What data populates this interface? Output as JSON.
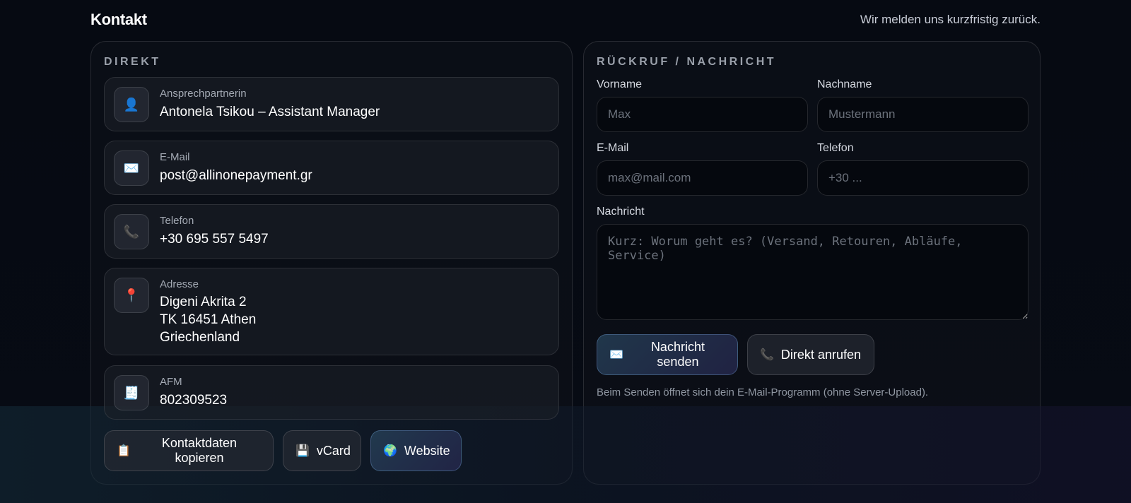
{
  "header": {
    "title": "Kontakt",
    "tagline": "Wir melden uns kurzfristig zurück."
  },
  "direct": {
    "section_title": "DIREKT",
    "contact_person": {
      "label": "Ansprechpartnerin",
      "value": "Antonela Tsikou – Assistant Manager",
      "icon": "👤"
    },
    "email": {
      "label": "E-Mail",
      "value": "post@allinonepayment.gr",
      "icon": "✉️"
    },
    "phone": {
      "label": "Telefon",
      "value": "+30 695 557 5497",
      "icon": "📞"
    },
    "address": {
      "label": "Adresse",
      "lines": [
        "Digeni Akrita 2",
        "TK 16451 Athen",
        "Griechenland"
      ],
      "icon": "📍"
    },
    "afm": {
      "label": "AFM",
      "value": "802309523",
      "icon": "🧾"
    },
    "buttons": {
      "copy": {
        "label": "Kontaktdaten kopieren",
        "icon": "📋"
      },
      "vcard": {
        "label": "vCard",
        "icon": "💾"
      },
      "website": {
        "label": "Website",
        "icon": "🌍"
      }
    }
  },
  "form": {
    "section_title": "RÜCKRUF / NACHRICHT",
    "firstname": {
      "label": "Vorname",
      "placeholder": "Max",
      "value": ""
    },
    "lastname": {
      "label": "Nachname",
      "placeholder": "Mustermann",
      "value": ""
    },
    "email": {
      "label": "E-Mail",
      "placeholder": "max@mail.com",
      "value": ""
    },
    "phone": {
      "label": "Telefon",
      "placeholder": "+30 ...",
      "value": ""
    },
    "message": {
      "label": "Nachricht",
      "placeholder": "Kurz: Worum geht es? (Versand, Retouren, Abläufe, Service)",
      "value": ""
    },
    "send_button": {
      "label": "Nachricht senden",
      "icon": "✉️"
    },
    "call_button": {
      "label": "Direkt anrufen",
      "icon": "📞"
    },
    "hint": "Beim Senden öffnet sich dein E-Mail-Programm (ohne Server-Upload)."
  },
  "colors": {
    "background": "#060a12",
    "panel_border": "#2a2f38",
    "accent_button": "#264258",
    "text_primary": "#ffffff",
    "text_muted": "#a4aab4"
  }
}
